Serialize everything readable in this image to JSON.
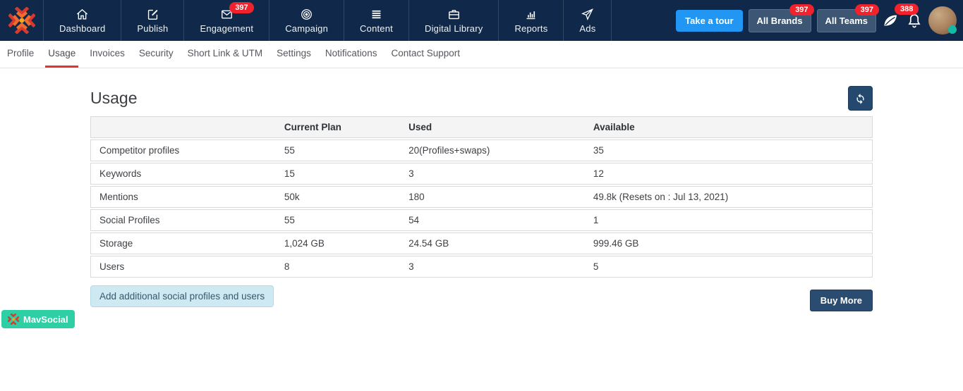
{
  "topnav": {
    "items": [
      {
        "label": "Dashboard",
        "icon": "home-icon"
      },
      {
        "label": "Publish",
        "icon": "edit-icon"
      },
      {
        "label": "Engagement",
        "icon": "envelope-icon",
        "badge": "397"
      },
      {
        "label": "Campaign",
        "icon": "target-icon"
      },
      {
        "label": "Content",
        "icon": "list-icon"
      },
      {
        "label": "Digital Library",
        "icon": "briefcase-icon"
      },
      {
        "label": "Reports",
        "icon": "bar-chart-icon"
      },
      {
        "label": "Ads",
        "icon": "paper-plane-icon"
      }
    ],
    "take_a_tour_label": "Take a tour",
    "all_brands_label": "All Brands",
    "all_brands_badge": "397",
    "all_teams_label": "All Teams",
    "all_teams_badge": "397",
    "notifications_badge": "388"
  },
  "tabs": {
    "active": "Usage",
    "items": [
      {
        "label": "Profile"
      },
      {
        "label": "Usage"
      },
      {
        "label": "Invoices"
      },
      {
        "label": "Security"
      },
      {
        "label": "Short Link & UTM"
      },
      {
        "label": "Settings"
      },
      {
        "label": "Notifications"
      },
      {
        "label": "Contact Support"
      }
    ]
  },
  "page": {
    "title": "Usage"
  },
  "table": {
    "headers": {
      "name": "",
      "current_plan": "Current Plan",
      "used": "Used",
      "available": "Available"
    },
    "rows": [
      {
        "name": "Competitor profiles",
        "current_plan": "55",
        "used": "20(Profiles+swaps)",
        "available": "35"
      },
      {
        "name": "Keywords",
        "current_plan": "15",
        "used": "3",
        "available": "12"
      },
      {
        "name": "Mentions",
        "current_plan": "50k",
        "used": "180",
        "available": "49.8k (Resets on : Jul 13, 2021)"
      },
      {
        "name": "Social Profiles",
        "current_plan": "55",
        "used": "54",
        "available": "1"
      },
      {
        "name": "Storage",
        "current_plan": "1,024 GB",
        "used": "24.54 GB",
        "available": "999.46 GB"
      },
      {
        "name": "Users",
        "current_plan": "8",
        "used": "3",
        "available": "5"
      }
    ]
  },
  "actions": {
    "add_label": "Add additional social profiles and users",
    "buy_more_label": "Buy More"
  },
  "footer_badge": {
    "label": "MavSocial"
  },
  "colors": {
    "topbar_navy": "#10294a",
    "badge_red": "#f1222b",
    "tour_blue": "#2196f3",
    "link_blue": "#2e7df6",
    "button_navy": "#2a4c70",
    "mavsocial_green": "#2ecfa5",
    "active_tab_red": "#e23431"
  }
}
